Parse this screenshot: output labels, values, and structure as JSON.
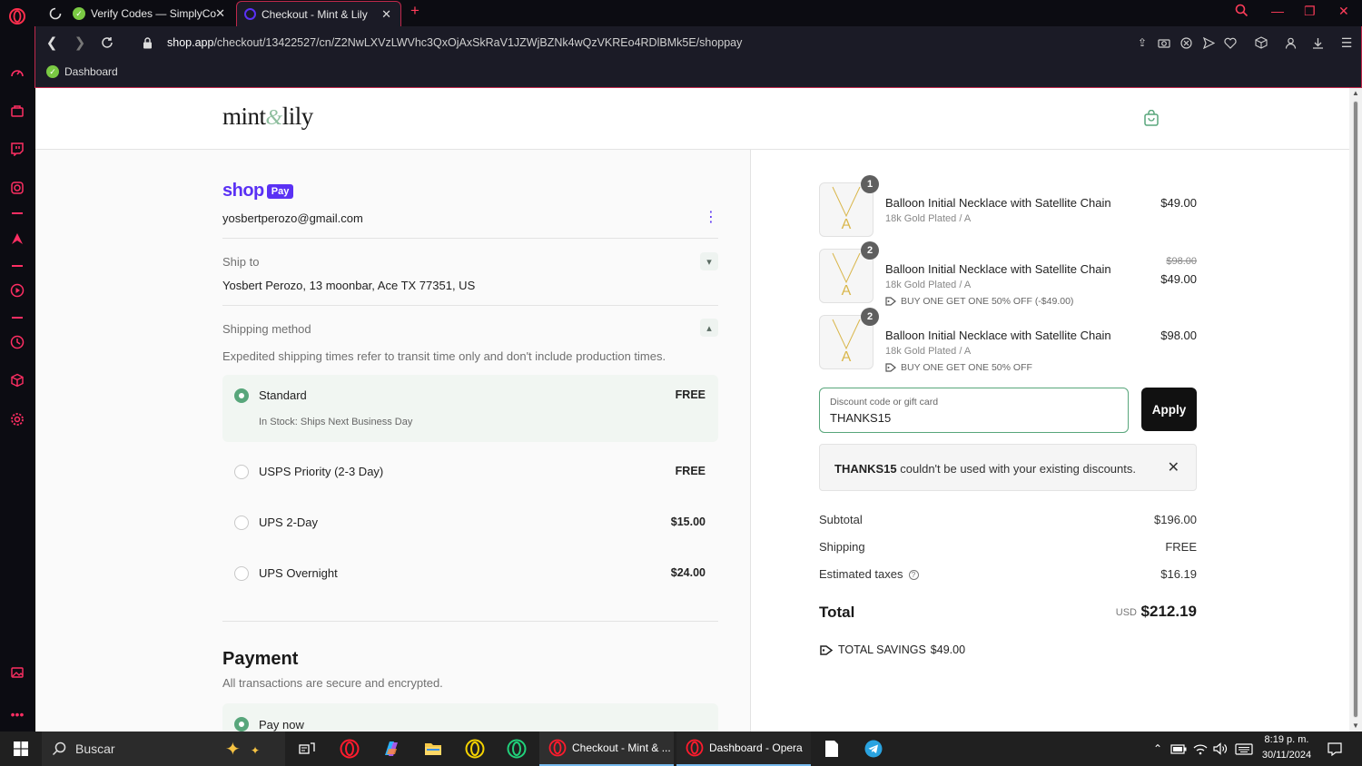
{
  "browser": {
    "tabs": [
      {
        "title": "Verify Codes — SimplyCodes",
        "active": false
      },
      {
        "title": "Checkout - Mint & Lily",
        "active": true
      }
    ],
    "url_host": "shop.app",
    "url_path": "/checkout/13422527/cn/Z2NwLXVzLWVhc3QxOjAxSkRaV1JZWjBZNk4wQzVKREo4RDlBMk5E/shoppay",
    "bookmark": "Dashboard",
    "accent_color": "#c0284b"
  },
  "store": {
    "logo_left": "mint",
    "logo_amp": "&",
    "logo_right": "lily"
  },
  "contact": {
    "shop_word": "shop",
    "pay_badge": "Pay",
    "email": "yosbertperozo@gmail.com"
  },
  "ship_to": {
    "label": "Ship to",
    "address": "Yosbert Perozo, 13 moonbar, Ace TX 77351, US"
  },
  "shipping_method": {
    "label": "Shipping method",
    "note": "Expedited shipping times refer to transit time only and don't include production times.",
    "options": [
      {
        "name": "Standard",
        "sub": "In Stock: Ships Next Business Day",
        "price": "FREE",
        "selected": true
      },
      {
        "name": "USPS Priority (2-3 Day)",
        "price": "FREE",
        "selected": false
      },
      {
        "name": "UPS 2-Day",
        "price": "$15.00",
        "selected": false
      },
      {
        "name": "UPS Overnight",
        "price": "$24.00",
        "selected": false
      }
    ]
  },
  "payment": {
    "title": "Payment",
    "subtitle": "All transactions are secure and encrypted.",
    "option": "Pay now"
  },
  "cart": {
    "items": [
      {
        "qty": "1",
        "name": "Balloon Initial Necklace with Satellite Chain",
        "variant": "18k Gold Plated / A",
        "price": "$49.00"
      },
      {
        "qty": "2",
        "name": "Balloon Initial Necklace with Satellite Chain",
        "variant": "18k Gold Plated / A",
        "discount": "BUY ONE GET ONE 50% OFF (-$49.00)",
        "original_price": "$98.00",
        "price": "$49.00"
      },
      {
        "qty": "2",
        "name": "Balloon Initial Necklace with Satellite Chain",
        "variant": "18k Gold Plated / A",
        "discount": "BUY ONE GET ONE 50% OFF",
        "price": "$98.00"
      }
    ],
    "discount_field": {
      "label": "Discount code or gift card",
      "value": "THANKS15"
    },
    "apply_label": "Apply",
    "error_code": "THANKS15",
    "error_message": " couldn't be used with your existing discounts.",
    "subtotal_label": "Subtotal",
    "subtotal": "$196.00",
    "shipping_label": "Shipping",
    "shipping": "FREE",
    "taxes_label": "Estimated taxes",
    "taxes": "$16.19",
    "total_label": "Total",
    "currency": "USD",
    "total": "$212.19",
    "savings_label": "TOTAL SAVINGS",
    "savings": "$49.00",
    "brand_color": "#5a31f4",
    "success_color": "#58a67b"
  },
  "taskbar": {
    "search_label": "Buscar",
    "windows": [
      {
        "title": "Checkout - Mint & ..."
      },
      {
        "title": "Dashboard - Opera"
      }
    ],
    "time": "8:19 p. m.",
    "date": "30/11/2024"
  }
}
